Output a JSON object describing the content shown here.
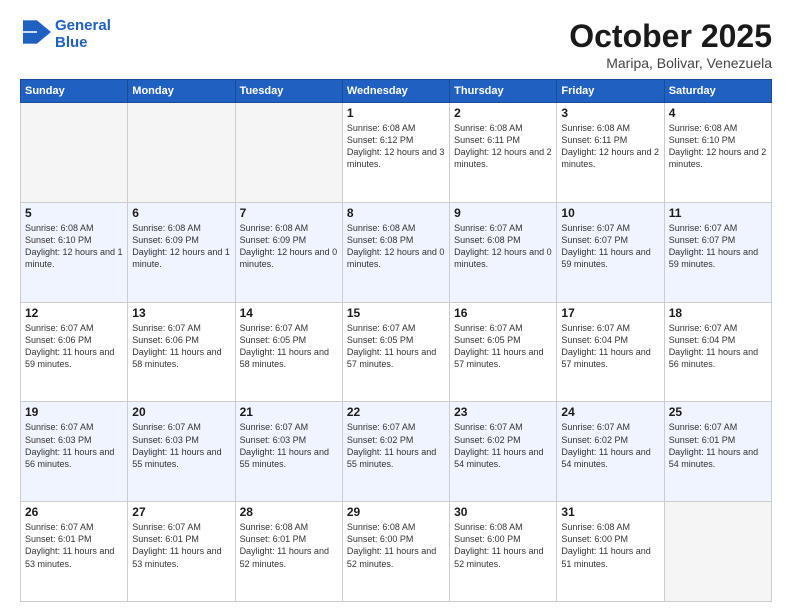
{
  "header": {
    "logo_line1": "General",
    "logo_line2": "Blue",
    "month": "October 2025",
    "location": "Maripa, Bolivar, Venezuela"
  },
  "days_of_week": [
    "Sunday",
    "Monday",
    "Tuesday",
    "Wednesday",
    "Thursday",
    "Friday",
    "Saturday"
  ],
  "weeks": [
    [
      {
        "day": "",
        "info": ""
      },
      {
        "day": "",
        "info": ""
      },
      {
        "day": "",
        "info": ""
      },
      {
        "day": "1",
        "info": "Sunrise: 6:08 AM\nSunset: 6:12 PM\nDaylight: 12 hours\nand 3 minutes."
      },
      {
        "day": "2",
        "info": "Sunrise: 6:08 AM\nSunset: 6:11 PM\nDaylight: 12 hours\nand 2 minutes."
      },
      {
        "day": "3",
        "info": "Sunrise: 6:08 AM\nSunset: 6:11 PM\nDaylight: 12 hours\nand 2 minutes."
      },
      {
        "day": "4",
        "info": "Sunrise: 6:08 AM\nSunset: 6:10 PM\nDaylight: 12 hours\nand 2 minutes."
      }
    ],
    [
      {
        "day": "5",
        "info": "Sunrise: 6:08 AM\nSunset: 6:10 PM\nDaylight: 12 hours\nand 1 minute."
      },
      {
        "day": "6",
        "info": "Sunrise: 6:08 AM\nSunset: 6:09 PM\nDaylight: 12 hours\nand 1 minute."
      },
      {
        "day": "7",
        "info": "Sunrise: 6:08 AM\nSunset: 6:09 PM\nDaylight: 12 hours\nand 0 minutes."
      },
      {
        "day": "8",
        "info": "Sunrise: 6:08 AM\nSunset: 6:08 PM\nDaylight: 12 hours\nand 0 minutes."
      },
      {
        "day": "9",
        "info": "Sunrise: 6:07 AM\nSunset: 6:08 PM\nDaylight: 12 hours\nand 0 minutes."
      },
      {
        "day": "10",
        "info": "Sunrise: 6:07 AM\nSunset: 6:07 PM\nDaylight: 11 hours\nand 59 minutes."
      },
      {
        "day": "11",
        "info": "Sunrise: 6:07 AM\nSunset: 6:07 PM\nDaylight: 11 hours\nand 59 minutes."
      }
    ],
    [
      {
        "day": "12",
        "info": "Sunrise: 6:07 AM\nSunset: 6:06 PM\nDaylight: 11 hours\nand 59 minutes."
      },
      {
        "day": "13",
        "info": "Sunrise: 6:07 AM\nSunset: 6:06 PM\nDaylight: 11 hours\nand 58 minutes."
      },
      {
        "day": "14",
        "info": "Sunrise: 6:07 AM\nSunset: 6:05 PM\nDaylight: 11 hours\nand 58 minutes."
      },
      {
        "day": "15",
        "info": "Sunrise: 6:07 AM\nSunset: 6:05 PM\nDaylight: 11 hours\nand 57 minutes."
      },
      {
        "day": "16",
        "info": "Sunrise: 6:07 AM\nSunset: 6:05 PM\nDaylight: 11 hours\nand 57 minutes."
      },
      {
        "day": "17",
        "info": "Sunrise: 6:07 AM\nSunset: 6:04 PM\nDaylight: 11 hours\nand 57 minutes."
      },
      {
        "day": "18",
        "info": "Sunrise: 6:07 AM\nSunset: 6:04 PM\nDaylight: 11 hours\nand 56 minutes."
      }
    ],
    [
      {
        "day": "19",
        "info": "Sunrise: 6:07 AM\nSunset: 6:03 PM\nDaylight: 11 hours\nand 56 minutes."
      },
      {
        "day": "20",
        "info": "Sunrise: 6:07 AM\nSunset: 6:03 PM\nDaylight: 11 hours\nand 55 minutes."
      },
      {
        "day": "21",
        "info": "Sunrise: 6:07 AM\nSunset: 6:03 PM\nDaylight: 11 hours\nand 55 minutes."
      },
      {
        "day": "22",
        "info": "Sunrise: 6:07 AM\nSunset: 6:02 PM\nDaylight: 11 hours\nand 55 minutes."
      },
      {
        "day": "23",
        "info": "Sunrise: 6:07 AM\nSunset: 6:02 PM\nDaylight: 11 hours\nand 54 minutes."
      },
      {
        "day": "24",
        "info": "Sunrise: 6:07 AM\nSunset: 6:02 PM\nDaylight: 11 hours\nand 54 minutes."
      },
      {
        "day": "25",
        "info": "Sunrise: 6:07 AM\nSunset: 6:01 PM\nDaylight: 11 hours\nand 54 minutes."
      }
    ],
    [
      {
        "day": "26",
        "info": "Sunrise: 6:07 AM\nSunset: 6:01 PM\nDaylight: 11 hours\nand 53 minutes."
      },
      {
        "day": "27",
        "info": "Sunrise: 6:07 AM\nSunset: 6:01 PM\nDaylight: 11 hours\nand 53 minutes."
      },
      {
        "day": "28",
        "info": "Sunrise: 6:08 AM\nSunset: 6:01 PM\nDaylight: 11 hours\nand 52 minutes."
      },
      {
        "day": "29",
        "info": "Sunrise: 6:08 AM\nSunset: 6:00 PM\nDaylight: 11 hours\nand 52 minutes."
      },
      {
        "day": "30",
        "info": "Sunrise: 6:08 AM\nSunset: 6:00 PM\nDaylight: 11 hours\nand 52 minutes."
      },
      {
        "day": "31",
        "info": "Sunrise: 6:08 AM\nSunset: 6:00 PM\nDaylight: 11 hours\nand 51 minutes."
      },
      {
        "day": "",
        "info": ""
      }
    ]
  ]
}
